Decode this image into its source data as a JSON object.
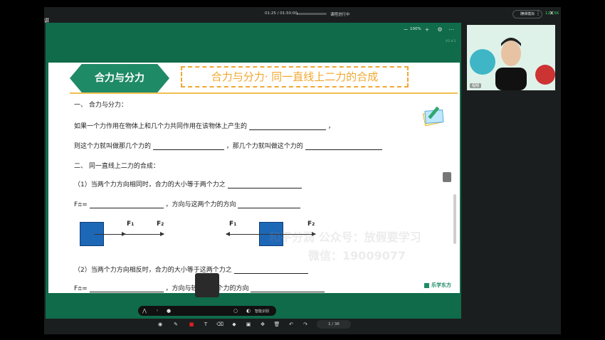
{
  "header": {
    "brand_fragment": "讲",
    "time": "01:25 / 01:50:00",
    "progress": 0.013,
    "status": "课程进行中",
    "mode_button": "随课模拟",
    "network": "122.5K",
    "icons": [
      "zoom-icon",
      "more-icon",
      "close-icon"
    ]
  },
  "slide_toolbar": {
    "zoom": "100%",
    "version": "V2.4.1"
  },
  "slide": {
    "chip": "合力与分力",
    "title": "合力与分力· 同一直线上二力的合成",
    "lines": [
      "一、 合力与分力：",
      "如果一个力作用在物体上和几个力共同作用在该物体上产生的",
      "，",
      "则这个力就叫做那几个力的",
      "，那几个力就叫做这个力的",
      "二、 同一直线上二力的合成：",
      "（1）当两个力方向相同时，合力的大小等于两个力之",
      "F",
      "合",
      "=",
      "，方向与这两个力的方向",
      "（2）当两个力方向相反时，合力的大小等于这两个力之",
      "，方向与较大的那个力的方向"
    ],
    "force_labels": {
      "f1": "F",
      "f1_sub": "1",
      "f2": "F",
      "f2_sub": "2"
    },
    "watermark": [
      "和平分润 公众号：放假要学习",
      "微信：19009077"
    ],
    "logo": "乐学东方"
  },
  "camera": {
    "name": "程翔"
  },
  "pen_toolbar": {
    "label": "智能识别"
  },
  "bottom_toolbar": {
    "page": "1 / 36"
  }
}
